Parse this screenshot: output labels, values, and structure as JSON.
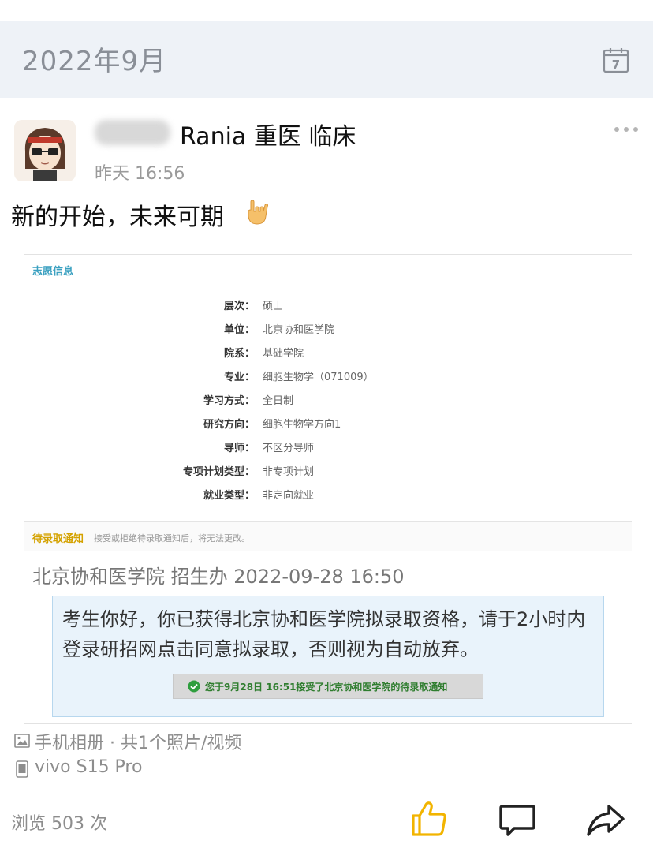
{
  "header": {
    "month_title": "2022年9月",
    "calendar_day": "7"
  },
  "post": {
    "author_name": "Rania 重医 临床",
    "time": "昨天 16:56",
    "text": "新的开始，未来可期",
    "source": "手机相册 · 共1个照片/视频",
    "device": "vivo S15 Pro",
    "views": "浏览 503 次"
  },
  "screenshot": {
    "section_title": "志愿信息",
    "rows": [
      {
        "label": "层次：",
        "value": "硕士"
      },
      {
        "label": "单位：",
        "value": "北京协和医学院"
      },
      {
        "label": "院系：",
        "value": "基础学院"
      },
      {
        "label": "专业：",
        "value": "细胞生物学（071009）"
      },
      {
        "label": "学习方式：",
        "value": "全日制"
      },
      {
        "label": "研究方向：",
        "value": "细胞生物学方向1"
      },
      {
        "label": "导师：",
        "value": "不区分导师"
      },
      {
        "label": "专项计划类型：",
        "value": "非专项计划"
      },
      {
        "label": "就业类型：",
        "value": "非定向就业"
      }
    ],
    "notice_title": "待录取通知",
    "notice_hint": "接受或拒绝待录取通知后，将无法更改。",
    "school_line": "北京协和医学院 招生办 2022-09-28 16:50",
    "message": "考生你好，你已获得北京协和医学院拟录取资格，请于2小时内登录研招网点击同意拟录取，否则视为自动放弃。",
    "accept_text": "您于9月28日 16:51接受了北京协和医学院的待录取通知"
  },
  "icons": {
    "calendar": "calendar-icon",
    "more": "more-icon",
    "like": "thumbs-up-icon",
    "comment": "comment-icon",
    "share": "share-icon",
    "photo": "photo-icon",
    "phone": "phone-icon"
  },
  "colors": {
    "like_accent": "#f2b400",
    "month_bar": "#eef2f7",
    "accept_green": "#2e7d2e"
  }
}
